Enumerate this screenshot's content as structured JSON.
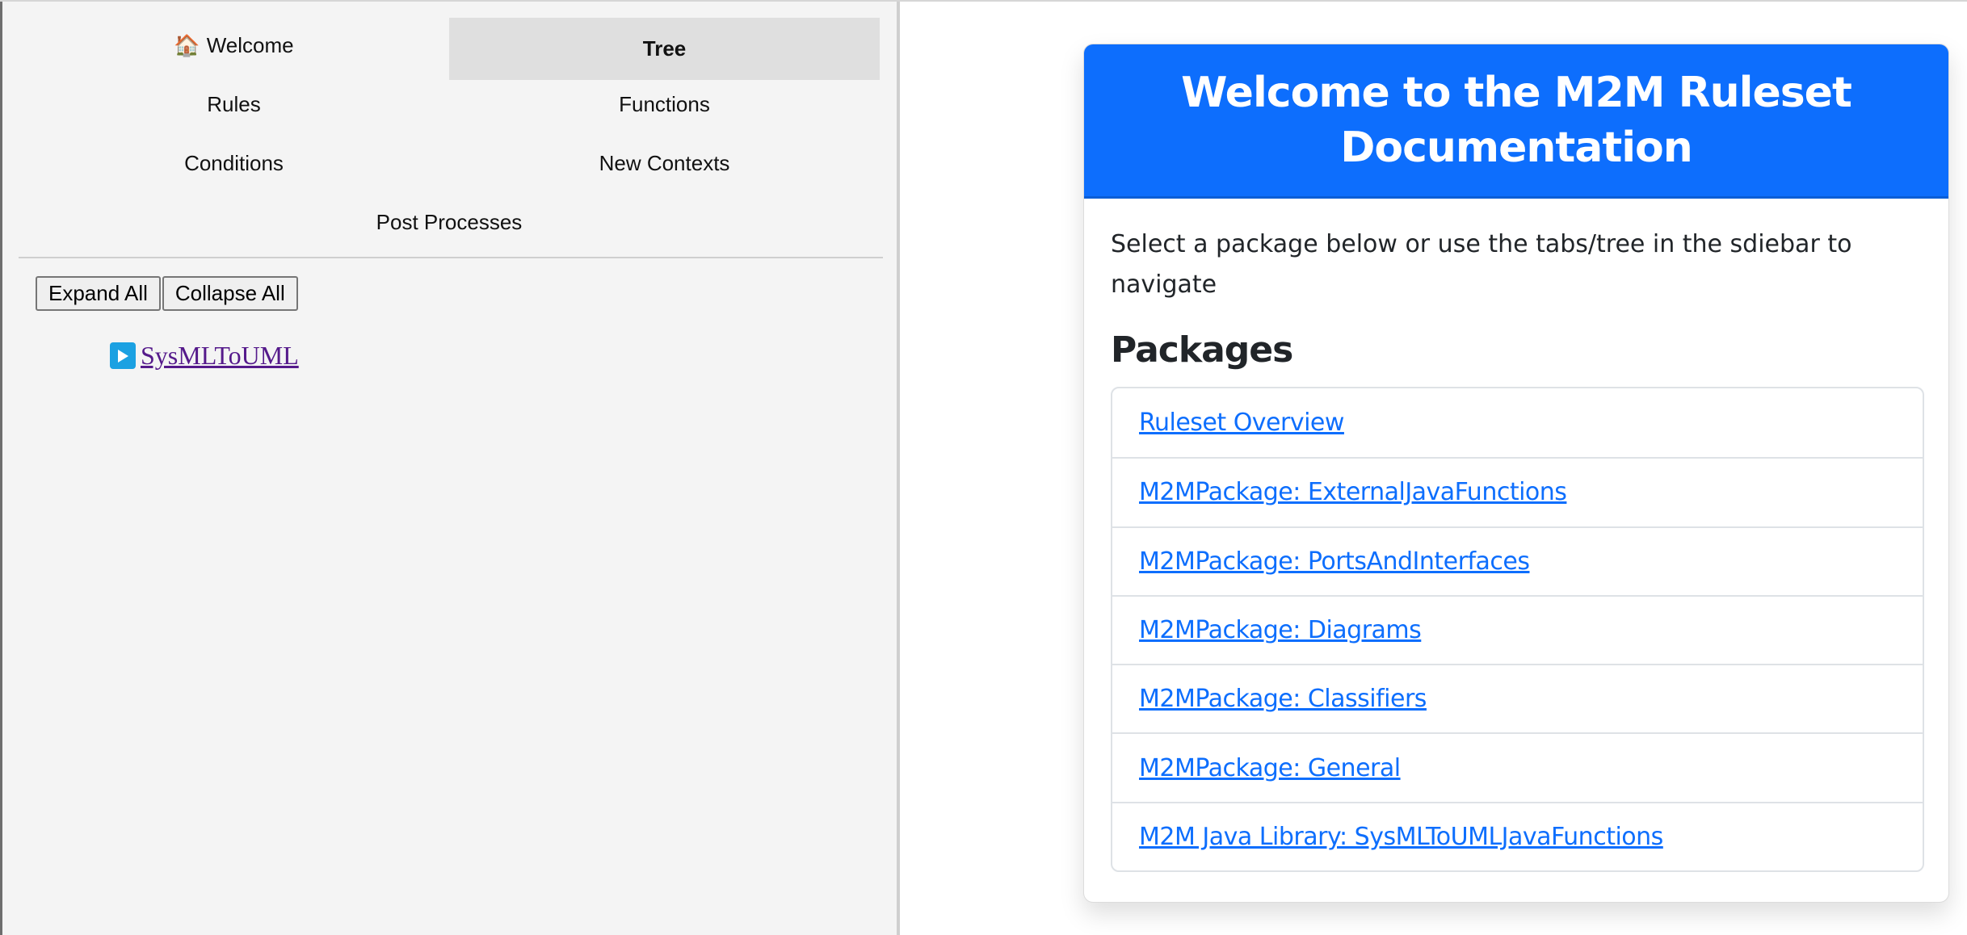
{
  "sidebar": {
    "tabs": [
      {
        "label": "Welcome",
        "icon": "house-emoji",
        "glyph": "🏠",
        "active": false
      },
      {
        "label": "Tree",
        "active": true
      },
      {
        "label": "Rules",
        "active": false
      },
      {
        "label": "Functions",
        "active": false
      },
      {
        "label": "Conditions",
        "active": false
      },
      {
        "label": "New Contexts",
        "active": false
      },
      {
        "label": "Post Processes",
        "active": false
      }
    ],
    "buttons": {
      "expand_all": "Expand All",
      "collapse_all": "Collapse All"
    },
    "tree": {
      "root": {
        "label": "SysMLToUML",
        "expanded": false,
        "toggle_icon": "play-triangle-icon"
      }
    }
  },
  "main": {
    "header": {
      "title": "Welcome to the M2M Ruleset Documentation"
    },
    "intro": "Select a package below or use the tabs/tree in the sdiebar to navigate",
    "packages_heading": "Packages",
    "packages": [
      {
        "label": "Ruleset Overview"
      },
      {
        "label": "M2MPackage: ExternalJavaFunctions"
      },
      {
        "label": "M2MPackage: PortsAndInterfaces"
      },
      {
        "label": "M2MPackage: Diagrams"
      },
      {
        "label": "M2MPackage: Classifiers"
      },
      {
        "label": "M2MPackage: General"
      },
      {
        "label": "M2M Java Library: SysMLToUMLJavaFunctions"
      }
    ]
  },
  "colors": {
    "accent": "#0d6efd",
    "sidebar_bg": "#f4f4f4",
    "active_tab_bg": "#dfdfdf",
    "visited_link": "#551a8b",
    "tree_toggle": "#1ba1e2"
  }
}
